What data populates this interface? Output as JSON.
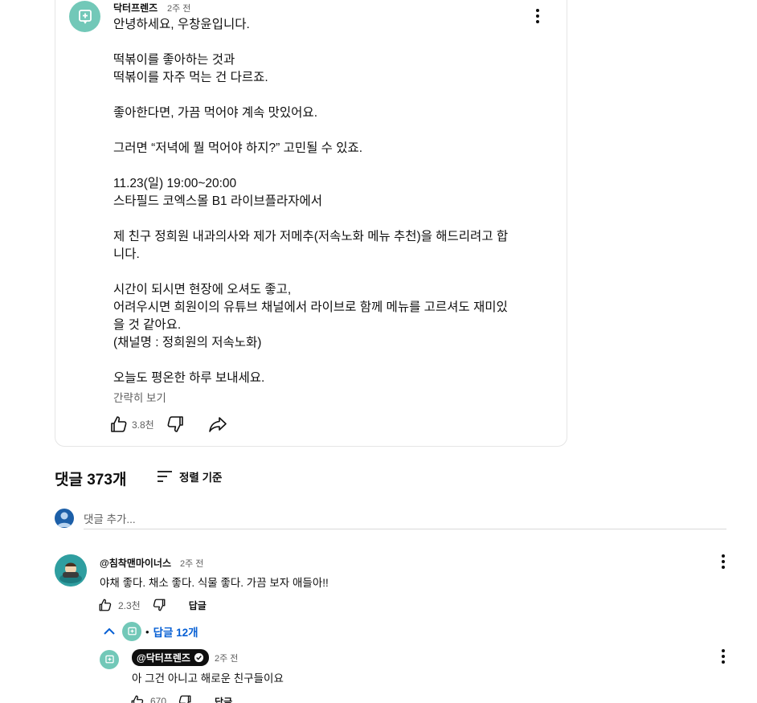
{
  "post": {
    "channel_name": "닥터프렌즈",
    "time": "2주 전",
    "body_lines": [
      "안녕하세요, 우창윤입니다.",
      "",
      "떡볶이를 좋아하는 것과",
      "떡볶이를 자주 먹는 건 다르죠.",
      "",
      "좋아한다면, 가끔 먹어야 계속 맛있어요.",
      "",
      "그러면 “저녁에 뭘 먹어야 하지?” 고민될 수 있죠.",
      "",
      "11.23(일) 19:00~20:00",
      "스타필드 코엑스몰 B1 라이브플라자에서",
      "",
      "제 친구 정희원 내과의사와 제가 저메추(저속노화 메뉴 추천)을 해드리려고 합",
      "니다.",
      "",
      "시간이 되시면 현장에 오셔도 좋고,",
      "어려우시면 희원이의 유튜브 채널에서 라이브로 함께 메뉴를 고르셔도 재미있",
      "을 것 같아요.",
      "(채널명 : 정희원의 저속노화)",
      "",
      "오늘도 평온한 하루 보내세요."
    ],
    "show_less": "간략히 보기",
    "like_count": "3.8천"
  },
  "comments_section": {
    "title": "댓글 373개",
    "sort_label": "정렬 기준",
    "add_placeholder": "댓글 추가..."
  },
  "comment": {
    "author": "@침착맨마이너스",
    "time": "2주 전",
    "text": "야채 좋다. 채소 좋다. 식물 좋다. 가끔 보자 애들아!!",
    "like_count": "2.3천",
    "reply_label": "답글",
    "replies_toggle": "답글 12개"
  },
  "reply": {
    "author": "@닥터프렌즈",
    "time": "2주 전",
    "text": "아 그건 아니고 해로운 친구들이요",
    "like_count": "670",
    "reply_label": "답글"
  },
  "colors": {
    "accent_blue": "#065fd4",
    "channel_teal": "#72c8b8",
    "border": "#e5e5e5",
    "secondary_text": "#606060"
  },
  "icons": [
    "community-plus-icon",
    "more-vert-icon",
    "thumb-up-icon",
    "thumb-down-icon",
    "share-icon",
    "sort-icon",
    "chevron-up-icon",
    "verified-check-icon"
  ]
}
